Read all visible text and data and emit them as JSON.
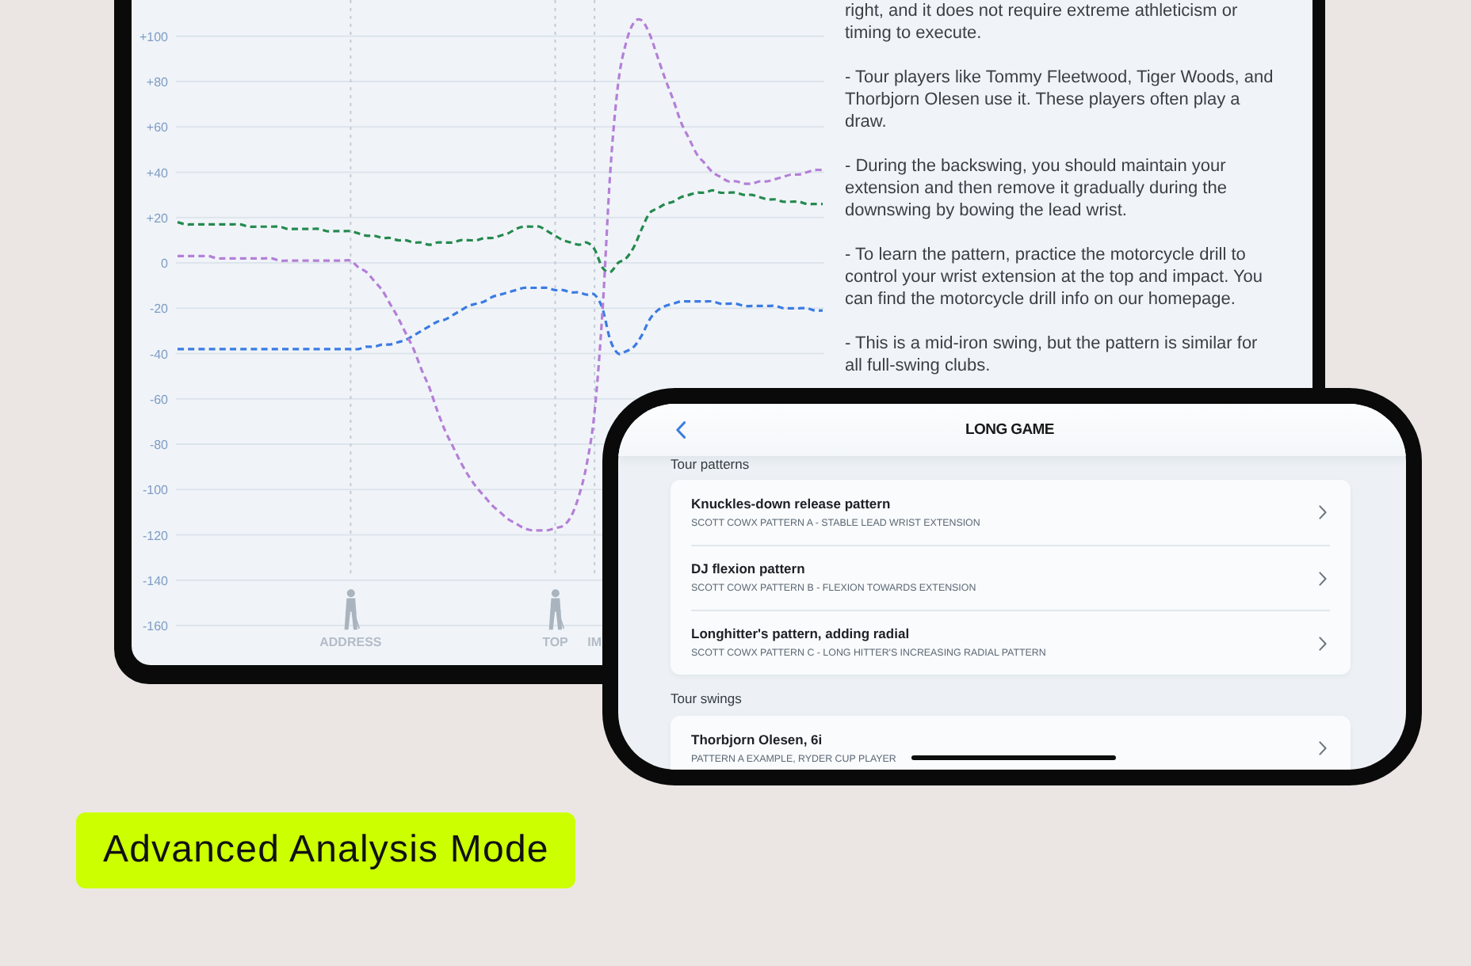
{
  "tablet": {
    "chart_data": {
      "type": "line",
      "grid": true,
      "categories": [
        null,
        null,
        null,
        null,
        null,
        null,
        null,
        null,
        null,
        null,
        null,
        null,
        null,
        null,
        null,
        null,
        null,
        null,
        null,
        null,
        null,
        null,
        "ADDRESS",
        null,
        null,
        null,
        null,
        null,
        null,
        null,
        null,
        null,
        null,
        null,
        null,
        null,
        null,
        null,
        null,
        null,
        null,
        null,
        null,
        null,
        null,
        null,
        null,
        null,
        "TOP",
        null,
        null,
        null,
        null,
        "IM",
        null,
        null,
        null,
        null,
        null,
        null,
        null,
        null,
        null,
        null,
        null,
        null,
        null,
        null,
        null,
        null,
        null,
        null,
        null,
        null,
        null,
        null,
        null,
        null,
        null,
        null,
        null,
        null,
        null
      ],
      "series": [
        {
          "color": "#25894f",
          "line_style": "dashed",
          "values": [
            18,
            17,
            17,
            17,
            17,
            17,
            17,
            17,
            17,
            16,
            16,
            16,
            16,
            16,
            15,
            15,
            15,
            15,
            15,
            14,
            14,
            14,
            14,
            13,
            12,
            12,
            11,
            11,
            10,
            10,
            9,
            9,
            8,
            9,
            9,
            9,
            10,
            10,
            10,
            11,
            11,
            12,
            13,
            15,
            16,
            16,
            16,
            14,
            12,
            10,
            9,
            8,
            9,
            6,
            -2,
            -4,
            0,
            2,
            7,
            15,
            22,
            24,
            26,
            27,
            29,
            30,
            31,
            31,
            32,
            31,
            31,
            31,
            30,
            30,
            29,
            28,
            28,
            27,
            27,
            27,
            26,
            26,
            26
          ]
        },
        {
          "color": "#3b7be3",
          "line_style": "dashed",
          "values": [
            -38,
            -38,
            -38,
            -38,
            -38,
            -38,
            -38,
            -38,
            -38,
            -38,
            -38,
            -38,
            -38,
            -38,
            -38,
            -38,
            -38,
            -38,
            -38,
            -38,
            -38,
            -38,
            -38,
            -38,
            -37,
            -37,
            -36,
            -36,
            -35,
            -34,
            -32,
            -30,
            -28,
            -26,
            -25,
            -23,
            -21,
            -19,
            -18,
            -17,
            -15,
            -14,
            -13,
            -12,
            -11,
            -11,
            -11,
            -11,
            -12,
            -12,
            -13,
            -13,
            -14,
            -14,
            -20,
            -34,
            -40,
            -39,
            -37,
            -32,
            -25,
            -21,
            -19,
            -18,
            -17,
            -17,
            -17,
            -17,
            -17,
            -18,
            -18,
            -18,
            -19,
            -19,
            -19,
            -19,
            -19,
            -20,
            -20,
            -20,
            -20,
            -21,
            -21
          ]
        },
        {
          "color": "#b47fd8",
          "line_style": "dashed",
          "values": [
            3,
            3,
            3,
            3,
            3,
            2,
            2,
            2,
            2,
            2,
            2,
            2,
            2,
            1,
            1,
            1,
            1,
            1,
            1,
            1,
            1,
            1,
            1,
            -2,
            -4,
            -8,
            -12,
            -18,
            -24,
            -31,
            -38,
            -47,
            -55,
            -65,
            -74,
            -81,
            -88,
            -94,
            -99,
            -103,
            -107,
            -110,
            -113,
            -115,
            -117,
            -118,
            -118,
            -118,
            -117,
            -116,
            -112,
            -103,
            -89,
            -66,
            -22,
            40,
            79,
            97,
            106,
            107,
            101,
            91,
            81,
            72,
            62,
            55,
            48,
            44,
            40,
            38,
            36,
            36,
            35,
            35,
            36,
            36,
            37,
            38,
            39,
            39,
            40,
            41,
            41
          ]
        }
      ],
      "ylim": [
        -160,
        116
      ],
      "yticks": [
        {
          "value": 100,
          "label": "+100"
        },
        {
          "value": 80,
          "label": "+80"
        },
        {
          "value": 60,
          "label": "+60"
        },
        {
          "value": 40,
          "label": "+40"
        },
        {
          "value": 20,
          "label": "+20"
        },
        0,
        -20,
        -40,
        -60,
        -80,
        -100,
        -120,
        -140,
        -160
      ]
    },
    "paragraphs": [
      "right, and it does not require extreme athleticism or timing to execute.",
      "- Tour players like Tommy Fleetwood, Tiger Woods, and Thorbjorn Olesen use it. These players often play a draw.",
      "- During the backswing, you should maintain your extension and then remove it gradually during the downswing by bowing the lead wrist.",
      "- To learn the pattern, practice the motorcycle drill to control your wrist extension at the top and impact. You can find the motorcycle drill info on our homepage.",
      "- This is a mid-iron swing, but the pattern is similar for all full-swing clubs."
    ]
  },
  "phone": {
    "title": "LONG GAME",
    "sections": [
      {
        "heading": "Tour patterns",
        "items": [
          {
            "title": "Knuckles-down release pattern",
            "subtitle": "SCOTT COWX PATTERN A - STABLE LEAD WRIST EXTENSION"
          },
          {
            "title": "DJ flexion pattern",
            "subtitle": "SCOTT COWX PATTERN B - FLEXION TOWARDS EXTENSION"
          },
          {
            "title": "Longhitter's pattern, adding radial",
            "subtitle": "SCOTT COWX PATTERN C - LONG HITTER'S INCREASING RADIAL PATTERN"
          }
        ]
      },
      {
        "heading": "Tour swings",
        "items": [
          {
            "title": "Thorbjorn Olesen, 6i",
            "subtitle": "PATTERN A EXAMPLE, RYDER CUP PLAYER"
          }
        ]
      }
    ]
  },
  "caption": "Advanced Analysis Mode"
}
